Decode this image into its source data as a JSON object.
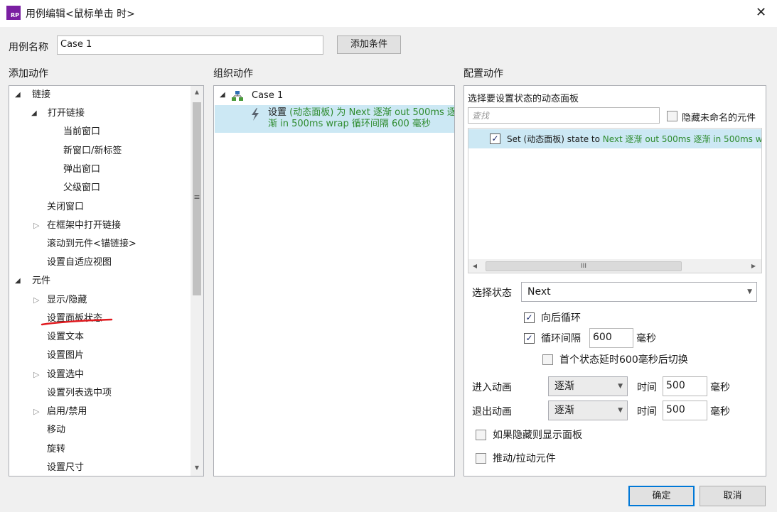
{
  "window": {
    "app_icon_text": "RP",
    "title": "用例编辑<鼠标单击 时>",
    "close_glyph": "✕"
  },
  "case_name": {
    "label": "用例名称",
    "value": "Case 1",
    "add_condition_label": "添加条件"
  },
  "add_actions": {
    "title": "添加动作",
    "items": [
      {
        "label": "链接"
      },
      {
        "label": "打开链接"
      },
      {
        "label": "当前窗口"
      },
      {
        "label": "新窗口/新标签"
      },
      {
        "label": "弹出窗口"
      },
      {
        "label": "父级窗口"
      },
      {
        "label": "关闭窗口"
      },
      {
        "label": "在框架中打开链接"
      },
      {
        "label": "滚动到元件<锚链接>"
      },
      {
        "label": "设置自适应视图"
      },
      {
        "label": "元件"
      },
      {
        "label": "显示/隐藏"
      },
      {
        "label": "设置面板状态"
      },
      {
        "label": "设置文本"
      },
      {
        "label": "设置图片"
      },
      {
        "label": "设置选中"
      },
      {
        "label": "设置列表选中项"
      },
      {
        "label": "启用/禁用"
      },
      {
        "label": "移动"
      },
      {
        "label": "旋转"
      },
      {
        "label": "设置尺寸"
      }
    ]
  },
  "organize_actions": {
    "title": "组织动作",
    "case_label": "Case 1",
    "action": {
      "prefix": "设置",
      "line1_green": "(动态面板) 为 Next 逐渐 out 500ms 逐",
      "line2": "渐 in 500ms wrap 循环间隔 600 毫秒"
    }
  },
  "configure_actions": {
    "title": "配置动作",
    "panel_title": "选择要设置状态的动态面板",
    "search_placeholder": "查找",
    "hide_unnamed_label": "隐藏未命名的元件",
    "hide_unnamed_checked": false,
    "target_row": {
      "checked": true,
      "prefix": "Set (动态面板) state to ",
      "suffix_green": "Next 逐渐 out 500ms 逐渐 in 500ms w"
    },
    "select_state_label": "选择状态",
    "select_state_value": "Next",
    "wrap_label": "向后循环",
    "wrap_checked": true,
    "repeat_label": "循环间隔",
    "repeat_checked": true,
    "repeat_value": "600",
    "repeat_unit": "毫秒",
    "first_delay_label": "首个状态延时600毫秒后切换",
    "first_delay_checked": false,
    "animate_in_label": "进入动画",
    "animate_in_value": "逐渐",
    "animate_in_time_label": "时间",
    "animate_in_time": "500",
    "animate_in_unit": "毫秒",
    "animate_out_label": "退出动画",
    "animate_out_value": "逐渐",
    "animate_out_time_label": "时间",
    "animate_out_time": "500",
    "animate_out_unit": "毫秒",
    "show_if_hidden_label": "如果隐藏则显示面板",
    "show_if_hidden_checked": false,
    "push_pull_label": "推动/拉动元件",
    "push_pull_checked": false
  },
  "footer": {
    "ok_label": "确定",
    "cancel_label": "取消"
  },
  "colors": {
    "accent": "#0078d7",
    "selection": "#cce8f4",
    "green_text": "#2e8b2e",
    "annotation_red": "#e0191e"
  }
}
